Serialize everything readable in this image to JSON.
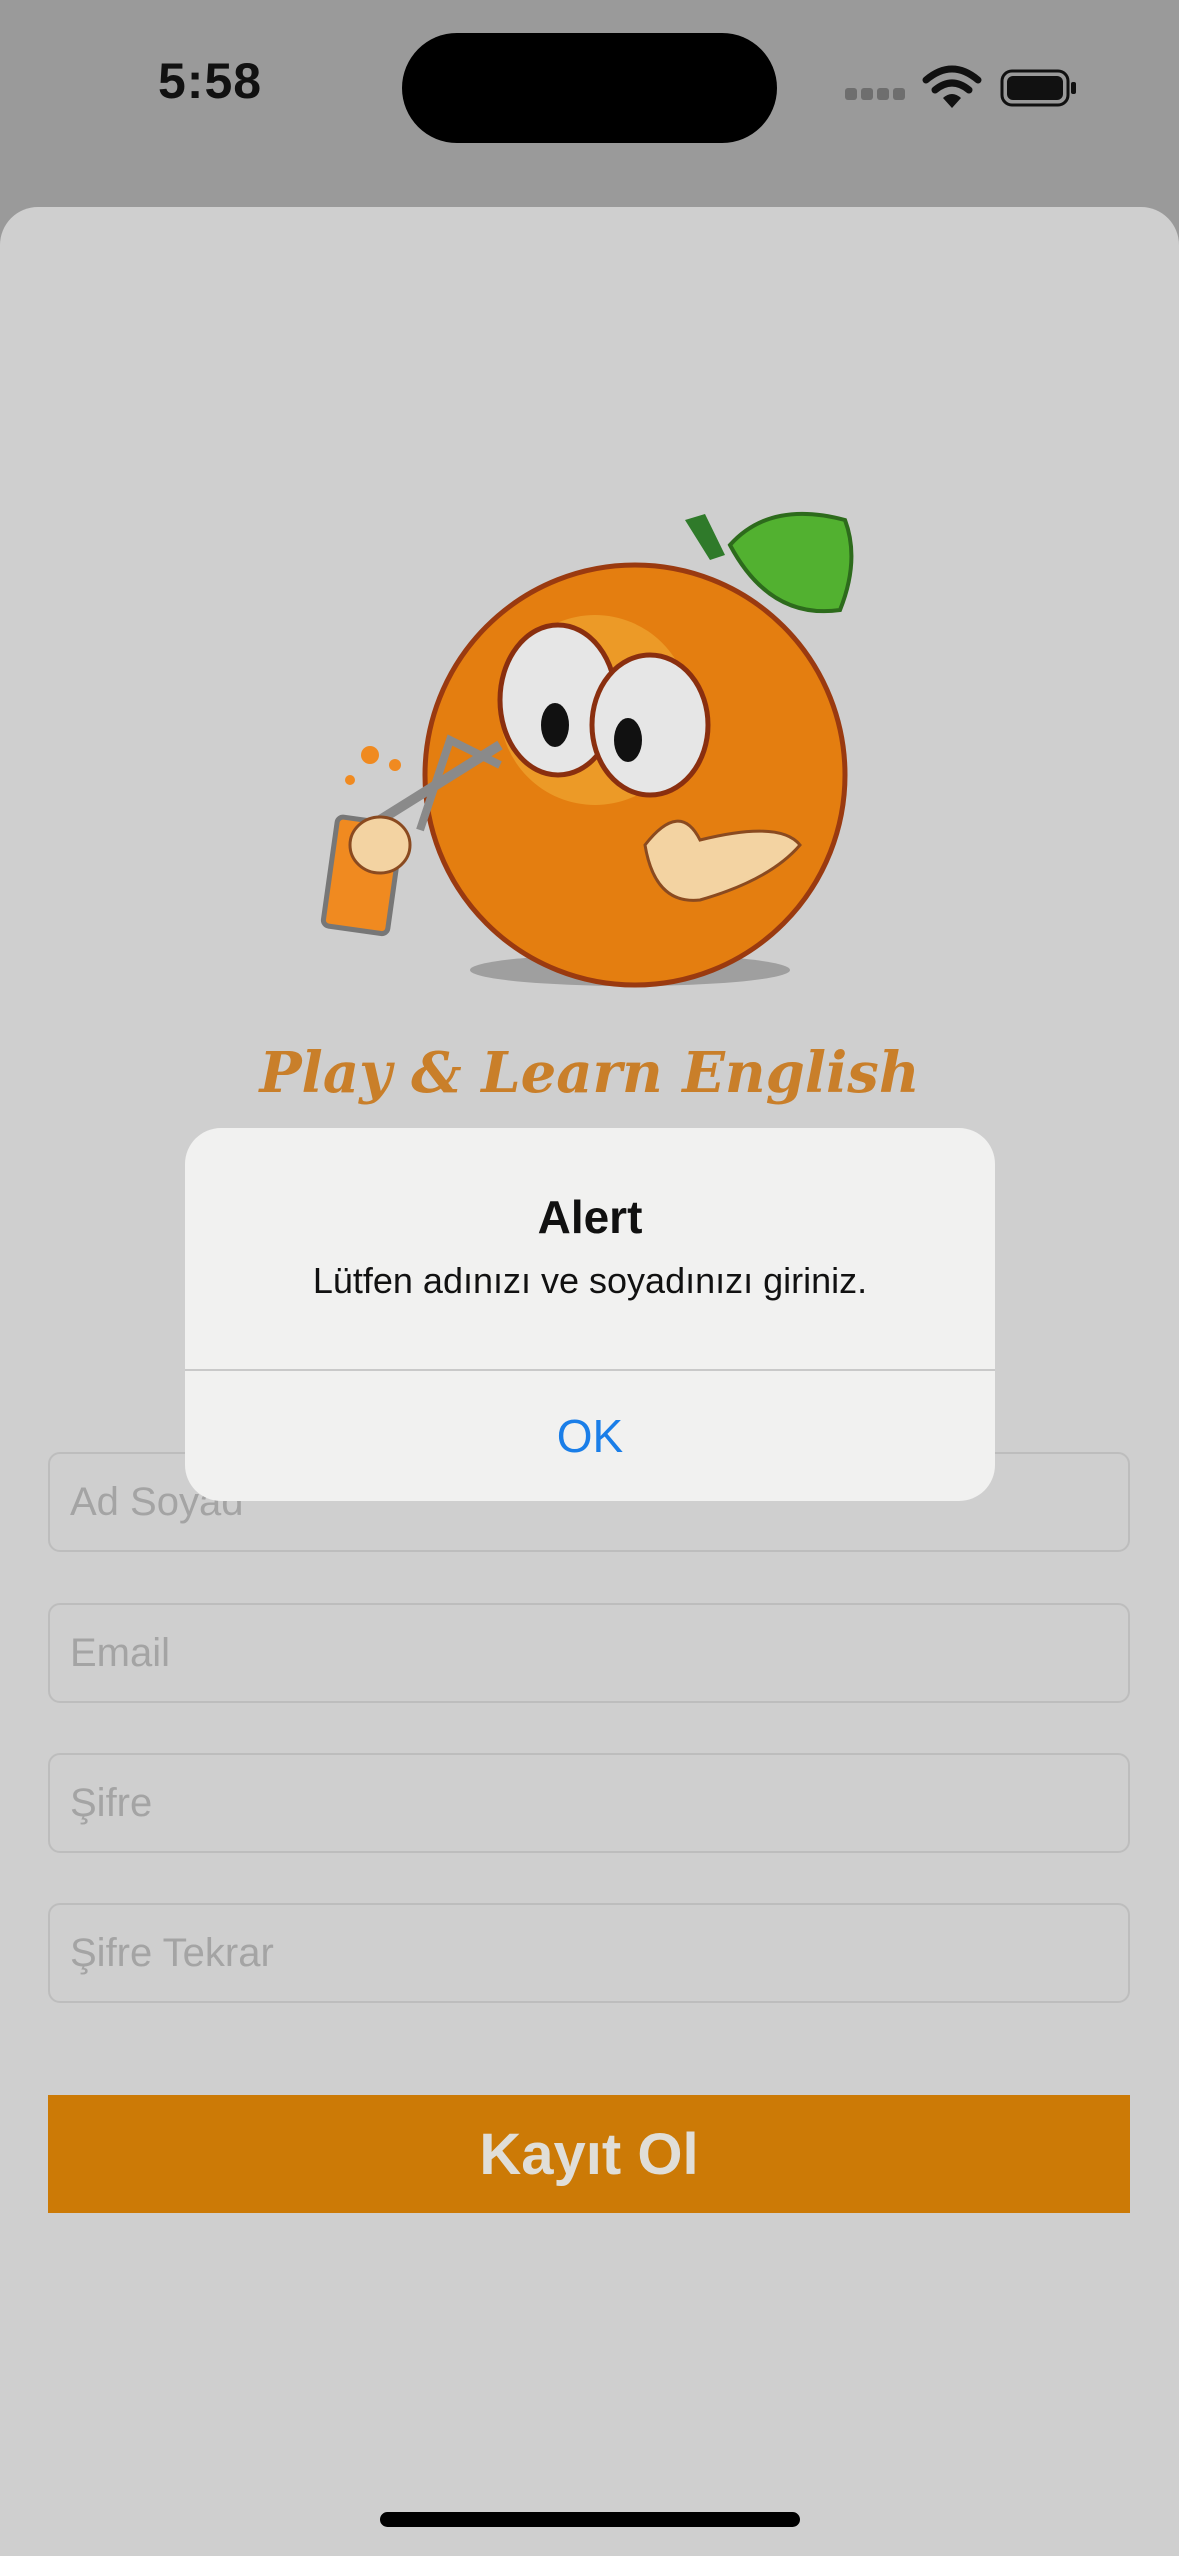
{
  "status_bar": {
    "time": "5:58"
  },
  "app": {
    "title": "Play & Learn English"
  },
  "form": {
    "name_placeholder": "Ad Soyad",
    "email_placeholder": "Email",
    "password_placeholder": "Şifre",
    "password_repeat_placeholder": "Şifre Tekrar",
    "register_label": "Kayıt Ol"
  },
  "alert": {
    "title": "Alert",
    "message": "Lütfen adınızı ve soyadınızı giriniz.",
    "ok_label": "OK"
  },
  "colors": {
    "accent": "#cc7a06",
    "title_orange": "#c97f2a",
    "alert_link": "#1a7ee8",
    "dimmed_bg": "#cfcfcf"
  },
  "icons": [
    "wifi-icon",
    "battery-icon",
    "signal-icon",
    "orange-mascot-logo"
  ]
}
